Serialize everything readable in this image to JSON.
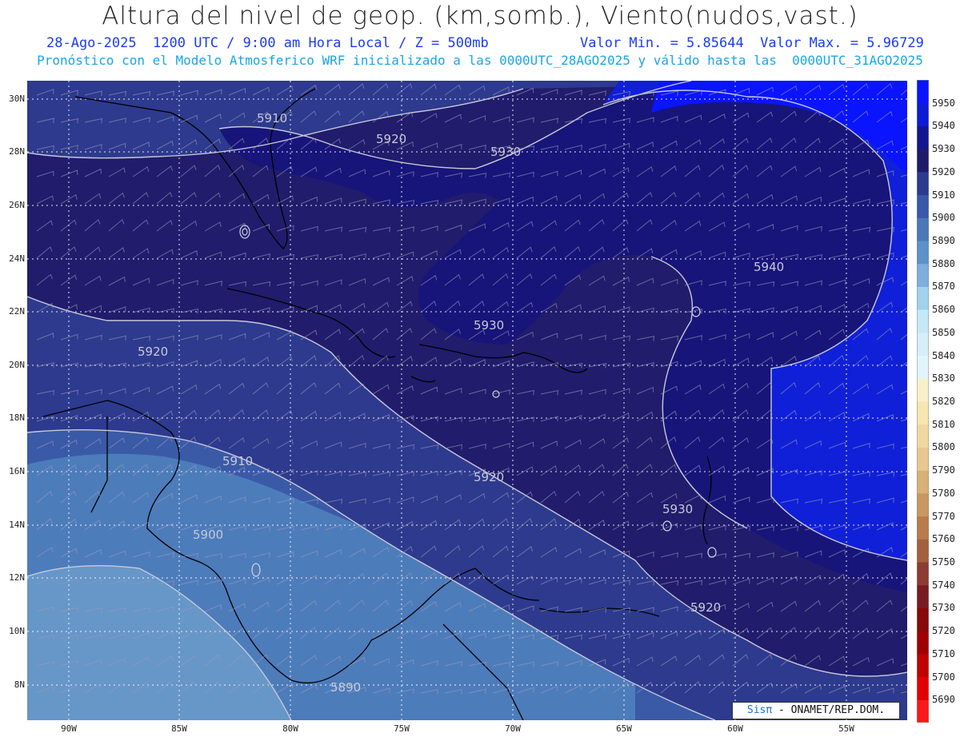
{
  "header": {
    "title": "Altura del nivel de geop. (km,somb.), Viento(nudos,vast.)",
    "date_time": "28-Ago-2025  1200 UTC / 9:00 am Hora Local / Z = 500mb",
    "min_max": "Valor Min. = 5.85644  Valor Max. = 5.96729",
    "model_line": "Pronóstico con el Modelo Atmosferico WRF inicializado a las 0000UTC_28AGO2025 y válido hasta las  0000UTC_31AGO2025"
  },
  "axes": {
    "lat_labels": [
      "30N",
      "28N",
      "26N",
      "24N",
      "22N",
      "20N",
      "18N",
      "16N",
      "14N",
      "12N",
      "10N",
      "8N"
    ],
    "lon_labels": [
      "90W",
      "85W",
      "80W",
      "75W",
      "70W",
      "65W",
      "60W",
      "55W"
    ]
  },
  "contours": {
    "labels": [
      "5910",
      "5920",
      "5930",
      "5940",
      "5930",
      "5920",
      "5910",
      "5920",
      "5930",
      "5920",
      "5900",
      "5890"
    ]
  },
  "colorbar": {
    "levels": [
      "5950",
      "5940",
      "5930",
      "5920",
      "5910",
      "5900",
      "5890",
      "5880",
      "5870",
      "5860",
      "5850",
      "5840",
      "5830",
      "5820",
      "5810",
      "5800",
      "5790",
      "5780",
      "5770",
      "5760",
      "5750",
      "5740",
      "5730",
      "5720",
      "5710",
      "5700",
      "5690"
    ],
    "colors": [
      "#0a14ff",
      "#0c1cd6",
      "#14168f",
      "#201a6a",
      "#2c3a90",
      "#3858a8",
      "#4a78b8",
      "#5c92c8",
      "#7eaedc",
      "#a0d2ec",
      "#c4e8f6",
      "#d6eef8",
      "#e2f4fb",
      "#f8f0c8",
      "#f6e6b0",
      "#f0d8a0",
      "#e8c890",
      "#d8b078",
      "#c89860",
      "#b87c4c",
      "#a4603c",
      "#8c3c30",
      "#781c20",
      "#880a0a",
      "#a00000",
      "#c00000",
      "#e40000",
      "#ff1818"
    ]
  },
  "map_colors": {
    "h5950": "#0a14ff",
    "h5940": "#1020d8",
    "h5930": "#17157a",
    "h5920": "#211c6c",
    "h5910": "#2d3a8e",
    "h5900": "#3a5aa8",
    "h5890": "#4d7cbb",
    "h5880": "#6796c9",
    "land": "#111111",
    "grid": "#ffffff"
  },
  "credit": {
    "brand": "Sisπ",
    "text": " - ONAMET/REP.DOM."
  }
}
